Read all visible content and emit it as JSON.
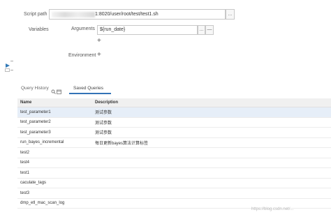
{
  "script_path": {
    "label": "Script path",
    "value": "1:8020/user/root/test/test1.sh",
    "browse_label": "..."
  },
  "variables": {
    "label": "Variables",
    "arguments_label": "Arguments",
    "argument_value": "${run_date}",
    "argument_more_label": "...",
    "remove_label": "—"
  },
  "environment": {
    "label": "Environment"
  },
  "tabs": [
    {
      "label": "Query History"
    },
    {
      "label": "Saved Queries"
    }
  ],
  "table": {
    "headers": [
      "Name",
      "Description"
    ],
    "rows": [
      {
        "name": "test_parameter1",
        "desc": "测试参数"
      },
      {
        "name": "test_parameter2",
        "desc": "测试参数"
      },
      {
        "name": "test_parameter3",
        "desc": "测试参数"
      },
      {
        "name": "run_bayes_incremental",
        "desc": "每日更新bayes算法计算标签"
      },
      {
        "name": "test2",
        "desc": ""
      },
      {
        "name": "test4",
        "desc": ""
      },
      {
        "name": "test1",
        "desc": ""
      },
      {
        "name": "caculate_tags",
        "desc": ""
      },
      {
        "name": "test3",
        "desc": ""
      },
      {
        "name": "dmp_etl_mac_scan_log",
        "desc": ""
      }
    ]
  },
  "watermark": "https://blog.csdn.net/...",
  "colors": {
    "accent": "#3373b7",
    "run_icon": "#337ab7"
  },
  "icons": [
    "play-icon",
    "plus-icon",
    "search-icon",
    "calendar-icon"
  ]
}
